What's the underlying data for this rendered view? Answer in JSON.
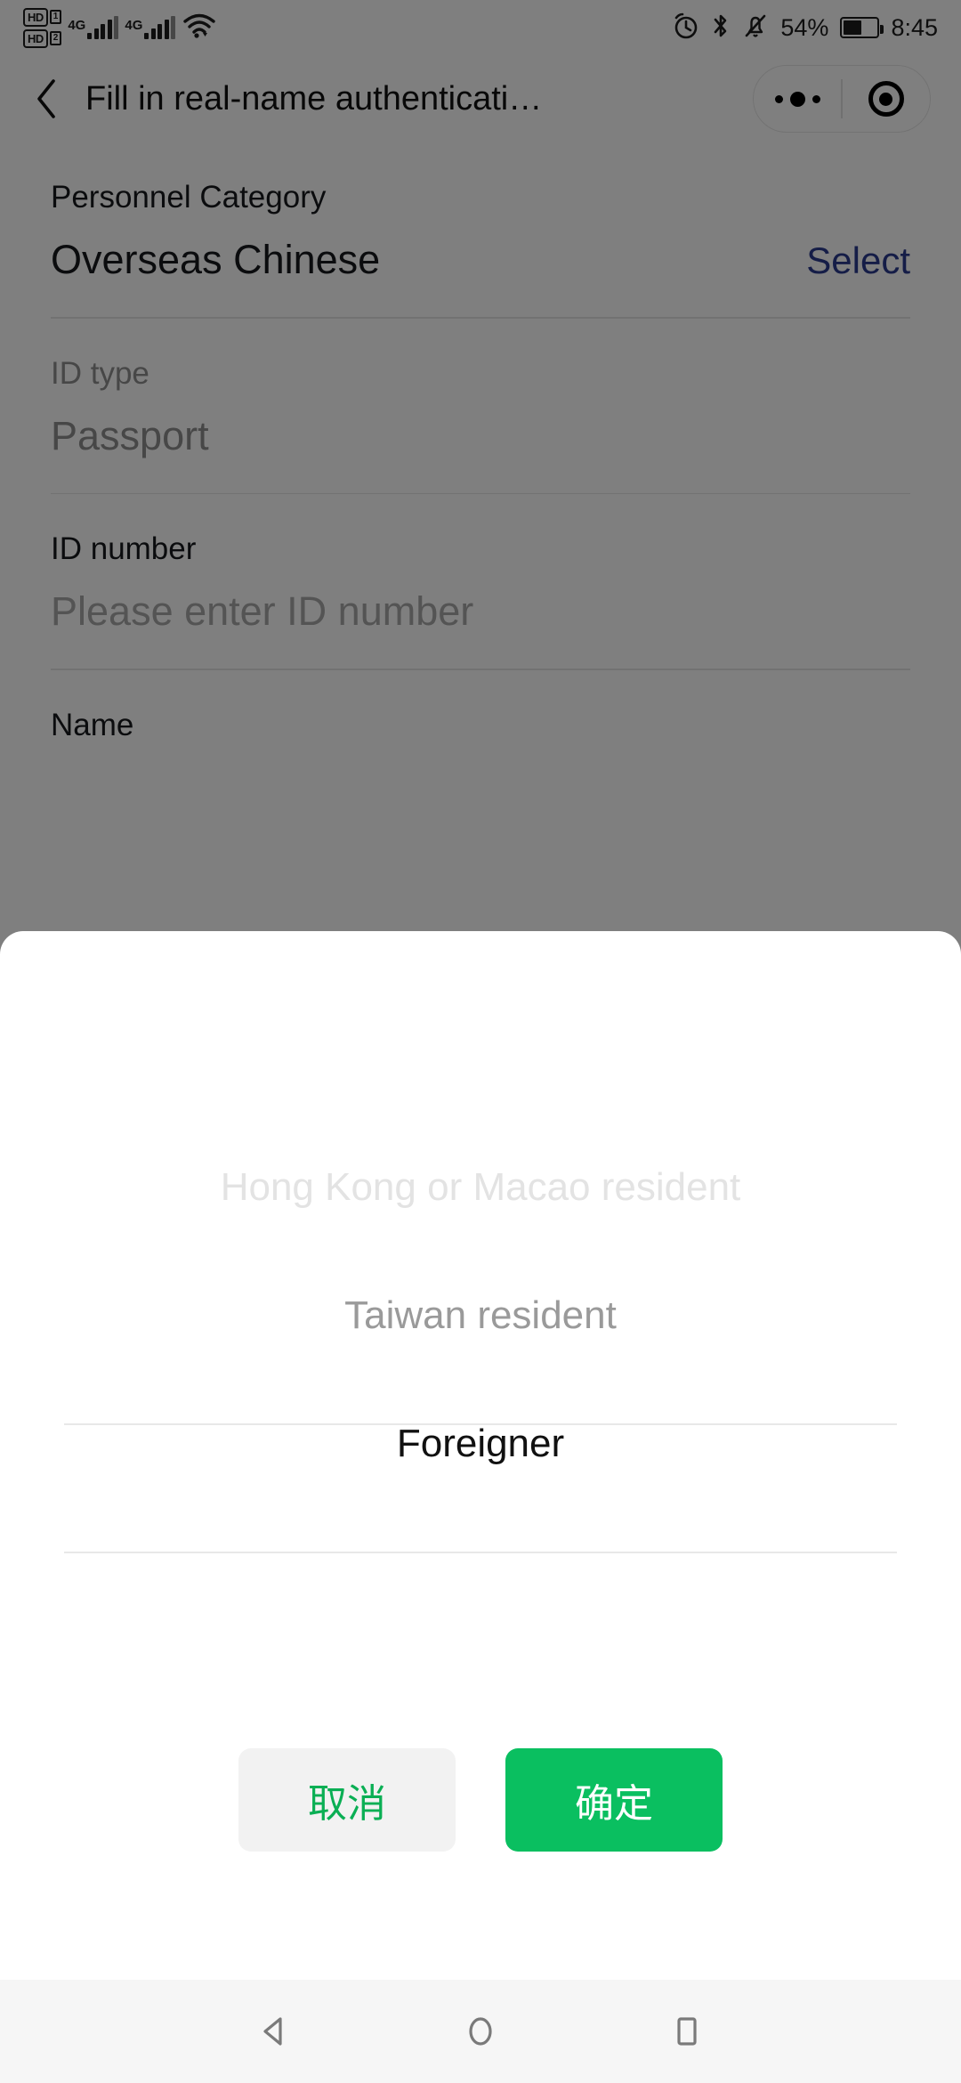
{
  "status_bar": {
    "sim1_badge": "HD",
    "sim1_num": "1",
    "sim2_badge": "HD",
    "sim2_num": "2",
    "network1": "4G",
    "network2": "4G",
    "wifi_icon": "wifi-icon",
    "alarm_icon": "alarm-clock-icon",
    "bluetooth_icon": "bluetooth-icon",
    "mute_icon": "bell-muted-icon",
    "battery_percent": "54%",
    "battery_level": 54,
    "time": "8:45"
  },
  "nav_header": {
    "back_icon": "chevron-left-icon",
    "title": "Fill in real-name authenticati…",
    "capsule": {
      "menu_icon": "ellipsis-icon",
      "target_icon": "target-icon"
    }
  },
  "form": {
    "fields": [
      {
        "label": "Personnel Category",
        "value": "Overseas Chinese",
        "action": "Select",
        "disabled": false,
        "is_placeholder": false
      },
      {
        "label": "ID type",
        "value": "Passport",
        "action": "",
        "disabled": true,
        "is_placeholder": false
      },
      {
        "label": "ID number",
        "value": "Please enter ID number",
        "action": "",
        "disabled": false,
        "is_placeholder": true
      },
      {
        "label": "Name",
        "value": "",
        "action": "",
        "disabled": false,
        "is_placeholder": false
      }
    ]
  },
  "sheet": {
    "picker": {
      "options": [
        "Hong Kong or Macao resident",
        "Taiwan resident",
        "Foreigner"
      ],
      "selected_index": 2,
      "selected_value": "Foreigner"
    },
    "cancel_label": "取消",
    "confirm_label": "确定"
  },
  "android_nav": {
    "back_icon": "triangle-back-icon",
    "home_icon": "circle-home-icon",
    "recents_icon": "square-recents-icon"
  },
  "colors": {
    "accent_green": "#0abf60",
    "cancel_text_green": "#0aaf54",
    "link_blue": "#2b3a8f",
    "dim_overlay": "rgba(0,0,0,0.5)",
    "sheet_bg": "#ffffff",
    "nav_bar_bg": "#f6f6f6"
  }
}
